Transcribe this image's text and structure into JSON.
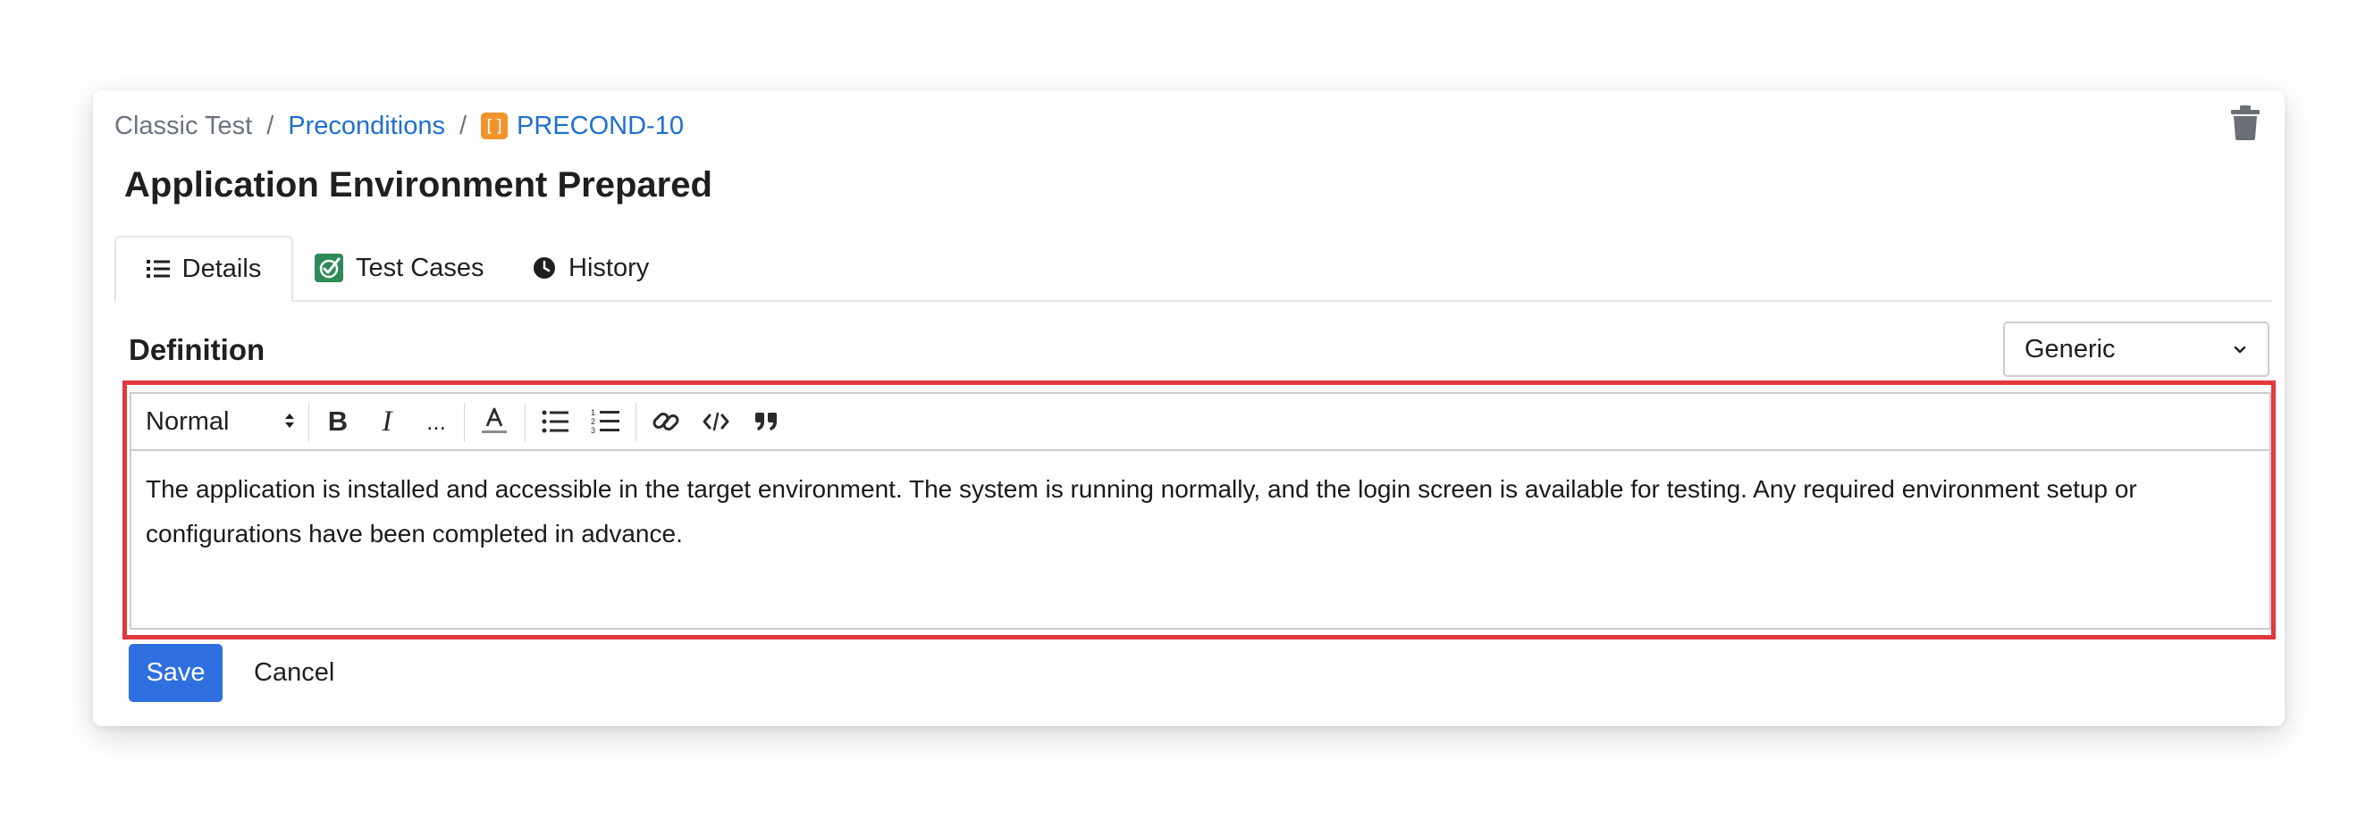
{
  "breadcrumb": {
    "project": "Classic Test",
    "separator": "/",
    "section": "Preconditions",
    "issue_icon": "[]",
    "issue_key": "PRECOND-10"
  },
  "page": {
    "title": "Application Environment Prepared"
  },
  "tabs": [
    {
      "label": "Details",
      "icon": "list-icon",
      "active": true
    },
    {
      "label": "Test Cases",
      "icon": "check-circle-icon",
      "active": false
    },
    {
      "label": "History",
      "icon": "clock-icon",
      "active": false
    }
  ],
  "definition": {
    "label": "Definition",
    "type_select": "Generic",
    "toolbar": {
      "format": "Normal",
      "bold": "B",
      "italic": "I",
      "more": "..."
    },
    "text": "The application is installed and accessible in the target environment. The system is running normally, and the login screen is available for testing. Any required environment setup or configurations have been completed in advance."
  },
  "actions": {
    "save_label": "Save",
    "cancel_label": "Cancel"
  },
  "colors": {
    "link": "#1f6fd1",
    "primary_button": "#2f6fdf",
    "highlight_border": "#e0393e",
    "issue_icon": "#f2932b",
    "test_cases_icon": "#2e8b57"
  }
}
